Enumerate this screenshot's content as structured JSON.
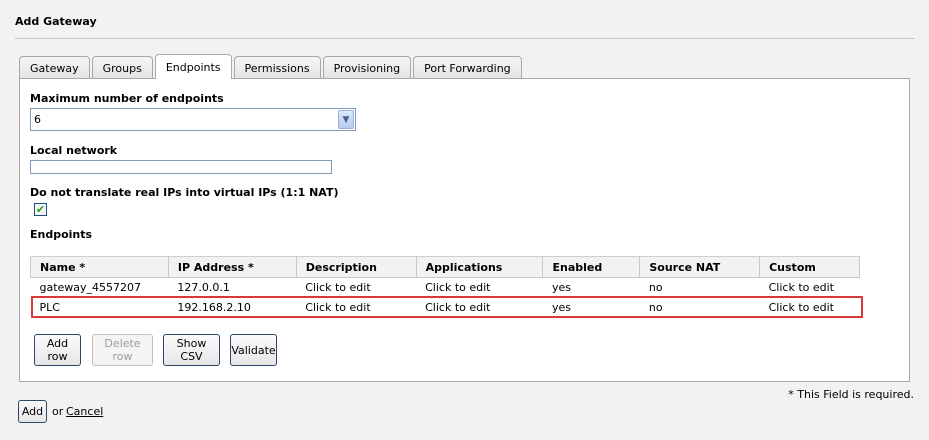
{
  "dialog": {
    "title": "Add Gateway"
  },
  "tabs": [
    {
      "label": "Gateway"
    },
    {
      "label": "Groups"
    },
    {
      "label": "Endpoints"
    },
    {
      "label": "Permissions"
    },
    {
      "label": "Provisioning"
    },
    {
      "label": "Port Forwarding"
    }
  ],
  "active_tab": "Endpoints",
  "form": {
    "max_endpoints_label": "Maximum number of endpoints",
    "max_endpoints_value": "6",
    "local_network_label": "Local network",
    "local_network_value": "",
    "nat_label": "Do not translate real IPs into virtual IPs (1:1 NAT)",
    "nat_checked": true,
    "endpoints_label": "Endpoints"
  },
  "table": {
    "headers": [
      "Name *",
      "IP Address *",
      "Description",
      "Applications",
      "Enabled",
      "Source NAT",
      "Custom"
    ],
    "rows": [
      [
        "gateway_4557207",
        "127.0.0.1",
        "Click to edit",
        "Click to edit",
        "yes",
        "no",
        "Click to edit"
      ],
      [
        "PLC",
        "192.168.2.10",
        "Click to edit",
        "Click to edit",
        "yes",
        "no",
        "Click to edit"
      ]
    ],
    "highlight_color": "#d7393b"
  },
  "buttons": {
    "add_row": "Add row",
    "delete_row": "Delete row",
    "show_csv": "Show CSV",
    "validate": "Validate"
  },
  "footer": {
    "required_note": "* This Field is required.",
    "add": "Add",
    "or": "or",
    "cancel": "Cancel"
  }
}
